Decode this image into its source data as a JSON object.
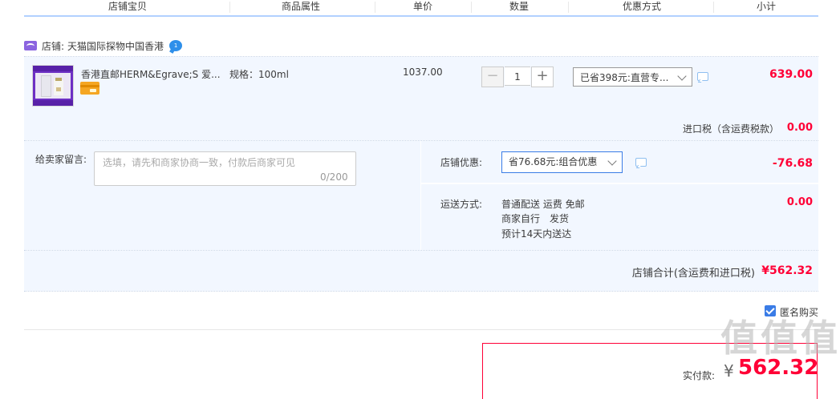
{
  "header": {
    "columns": [
      "店铺宝贝",
      "商品属性",
      "单价",
      "数量",
      "优惠方式",
      "小计"
    ]
  },
  "shop": {
    "label": "店铺:",
    "name": "天猫国际探物中国香港",
    "chat_badge": "1"
  },
  "item": {
    "title": "香港直邮HERM&Egrave;S 爱...",
    "spec": "规格：100ml",
    "unit_price": "1037.00",
    "quantity": "1",
    "promo": "已省398元:直营专...",
    "subtotal": "639.00"
  },
  "import_tax": {
    "label": "进口税（含运费税款）",
    "value": "0.00"
  },
  "message": {
    "label": "给卖家留言:",
    "placeholder": "选填，请先和商家协商一致，付款后商家可见",
    "counter": "0/200"
  },
  "shop_discount": {
    "label": "店铺优惠:",
    "selected": "省76.68元:组合优惠",
    "value": "-76.68"
  },
  "shipping": {
    "label": "运送方式:",
    "line1": "普通配送 运费 免邮",
    "line2": "商家自行　发货",
    "line3": "预计14天内送达",
    "value": "0.00"
  },
  "shop_total": {
    "label": "店铺合计(含运费和进口税)",
    "value": "¥562.32"
  },
  "anonymous": {
    "label": "匿名购买",
    "checked": true
  },
  "payment": {
    "label": "实付款:",
    "currency": "¥",
    "amount": "562.32"
  },
  "watermark": "值 值 值",
  "colors": {
    "price_red": "#ff0036",
    "accent_blue": "#3a7ce6",
    "area_blue": "#f2f7ff"
  }
}
